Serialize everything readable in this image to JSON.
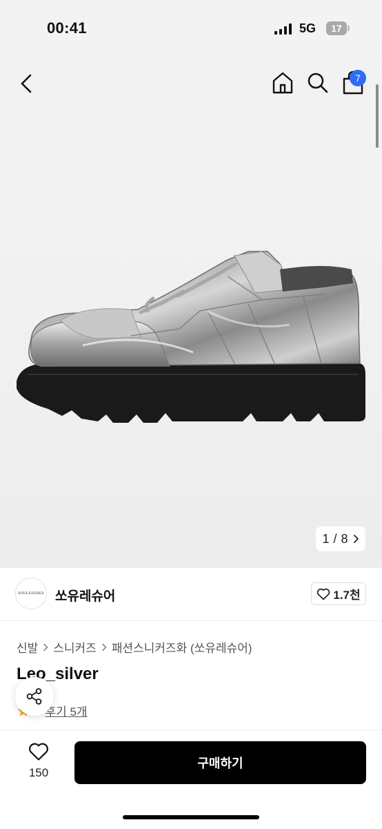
{
  "status_bar": {
    "time": "00:41",
    "network": "5G",
    "battery": "17"
  },
  "header": {
    "cart_count": "7"
  },
  "gallery": {
    "current": "1",
    "total": "8",
    "separator": "/"
  },
  "brand": {
    "logo_text": "SOULESURES",
    "name": "쏘유레슈어",
    "likes": "1.7천"
  },
  "breadcrumb": [
    "신발",
    "스니커즈",
    "패션스니커즈화 (쏘유레슈어)"
  ],
  "product": {
    "title": "Leo_silver",
    "rating": "5",
    "reviews": "후기 5개"
  },
  "bottom_bar": {
    "wish_count": "150",
    "buy_label": "구매하기"
  },
  "colors": {
    "accent": "#2e6cf5",
    "star": "#f5a623",
    "buy": "#000000"
  },
  "icons": [
    "back-icon",
    "home-icon",
    "search-icon",
    "cart-icon",
    "share-icon",
    "heart-icon",
    "star-icon",
    "chevron-right-icon"
  ]
}
